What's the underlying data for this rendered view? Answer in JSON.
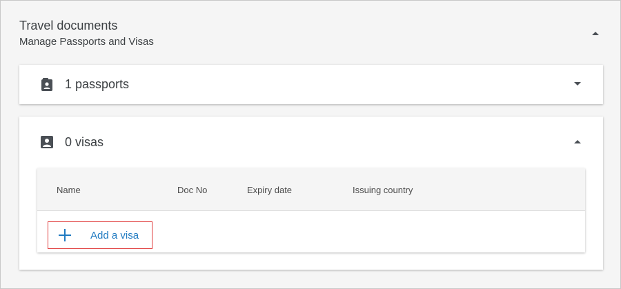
{
  "section": {
    "title": "Travel documents",
    "subtitle": "Manage Passports and Visas"
  },
  "passports": {
    "label": "1 passports",
    "icon": "passport-icon"
  },
  "visas": {
    "label": "0 visas",
    "icon": "visa-id-icon",
    "table": {
      "columns": [
        "Name",
        "Doc No",
        "Expiry date",
        "Issuing country"
      ]
    },
    "add_label": "Add a visa"
  },
  "colors": {
    "accent": "#1f7ac1",
    "highlight_border": "#e03a3a",
    "icon": "#4a4f55"
  }
}
